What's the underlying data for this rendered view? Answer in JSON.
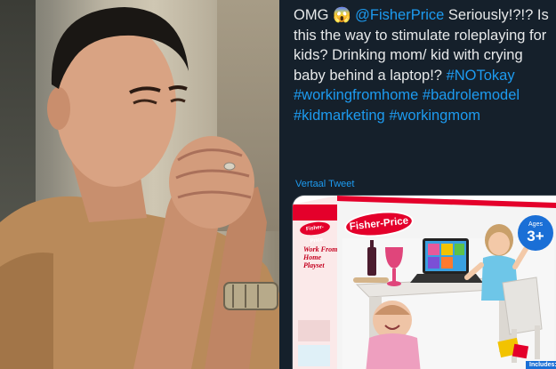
{
  "tweet": {
    "segments": [
      {
        "text": "OMG 😱 ",
        "link": false
      },
      {
        "text": "@FisherPrice",
        "link": true
      },
      {
        "text": " Seriously!?!? Is this the way to stimulate roleplaying for kids? Drinking mom/ kid with crying baby behind a laptop!? ",
        "link": false
      },
      {
        "text": "#NOTokay",
        "link": true
      },
      {
        "text": " ",
        "link": false
      },
      {
        "text": "#workingfromhome",
        "link": true
      },
      {
        "text": " ",
        "link": false
      },
      {
        "text": "#badrolemodel",
        "link": true
      },
      {
        "text": " ",
        "link": false
      },
      {
        "text": "#kidmarketing",
        "link": true
      },
      {
        "text": " ",
        "link": false
      },
      {
        "text": "#workingmom",
        "link": true
      }
    ],
    "translate_label": "Vertaal Tweet"
  },
  "product_box": {
    "brand": "Fisher-Price",
    "side_brand": "Fisher-Price",
    "playset_name": "Work From Home Playset",
    "age_label": "Ages",
    "age_value": "3+",
    "includes_label": "Includes:"
  },
  "colors": {
    "tweet_background": "#15202b",
    "link": "#1d9bf0",
    "text": "#e7e9ea",
    "brand_red": "#e4002b",
    "age_badge_blue": "#1a6fd6"
  }
}
